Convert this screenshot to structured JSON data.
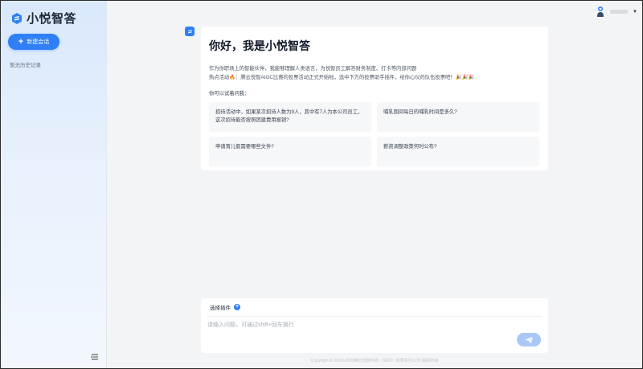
{
  "sidebar": {
    "brand_name": "小悦智答",
    "new_chat_label": "新建会话",
    "history_empty": "暂无历史记录"
  },
  "welcome": {
    "title": "你好，我是小悦智答",
    "intro_line1": "作为你职场上的智能伙伴，我能够理解人类语言，为悦智员工解答财务制度、打卡等内部问题",
    "intro_line2_a": "热点活动🔥：腾云悦智AIGC比赛的投票活动正式开始啦，选中下方的投票助手插件，给你心仪的队伍投票吧！",
    "intro_line2_b": "🎉🎉🎉",
    "try_label": "你可以试着问我：",
    "suggestions": [
      "招待活动中，如果某次招待人数为9人，其中有7人为本公司员工，这次招待能否按照团建费用报销?",
      "哺乳期间每日的哺乳时间是多久?",
      "申请育儿假需要哪些文件?",
      "薪资调整政策何时公布?"
    ]
  },
  "input": {
    "plugin_label": "选择插件",
    "placeholder": "请输入问题，可通过shift+回车换行"
  },
  "footer": {
    "copyright": "Copyright © 2018-2020腾云悦智科技（深圳）有限责任公司 版权所有"
  },
  "colors": {
    "accent": "#2f7ff6",
    "send_disabled": "#a9c8f7",
    "sidebar_top": "#d9e8fb",
    "page_bg": "#f3f4f6"
  },
  "icons": {
    "brand": "brand-logo-icon",
    "new_chat": "plus-icon",
    "collapse": "sidebar-collapse-icon",
    "send": "send-icon",
    "avatar": "user-avatar-icon",
    "bot": "bot-avatar-icon"
  }
}
